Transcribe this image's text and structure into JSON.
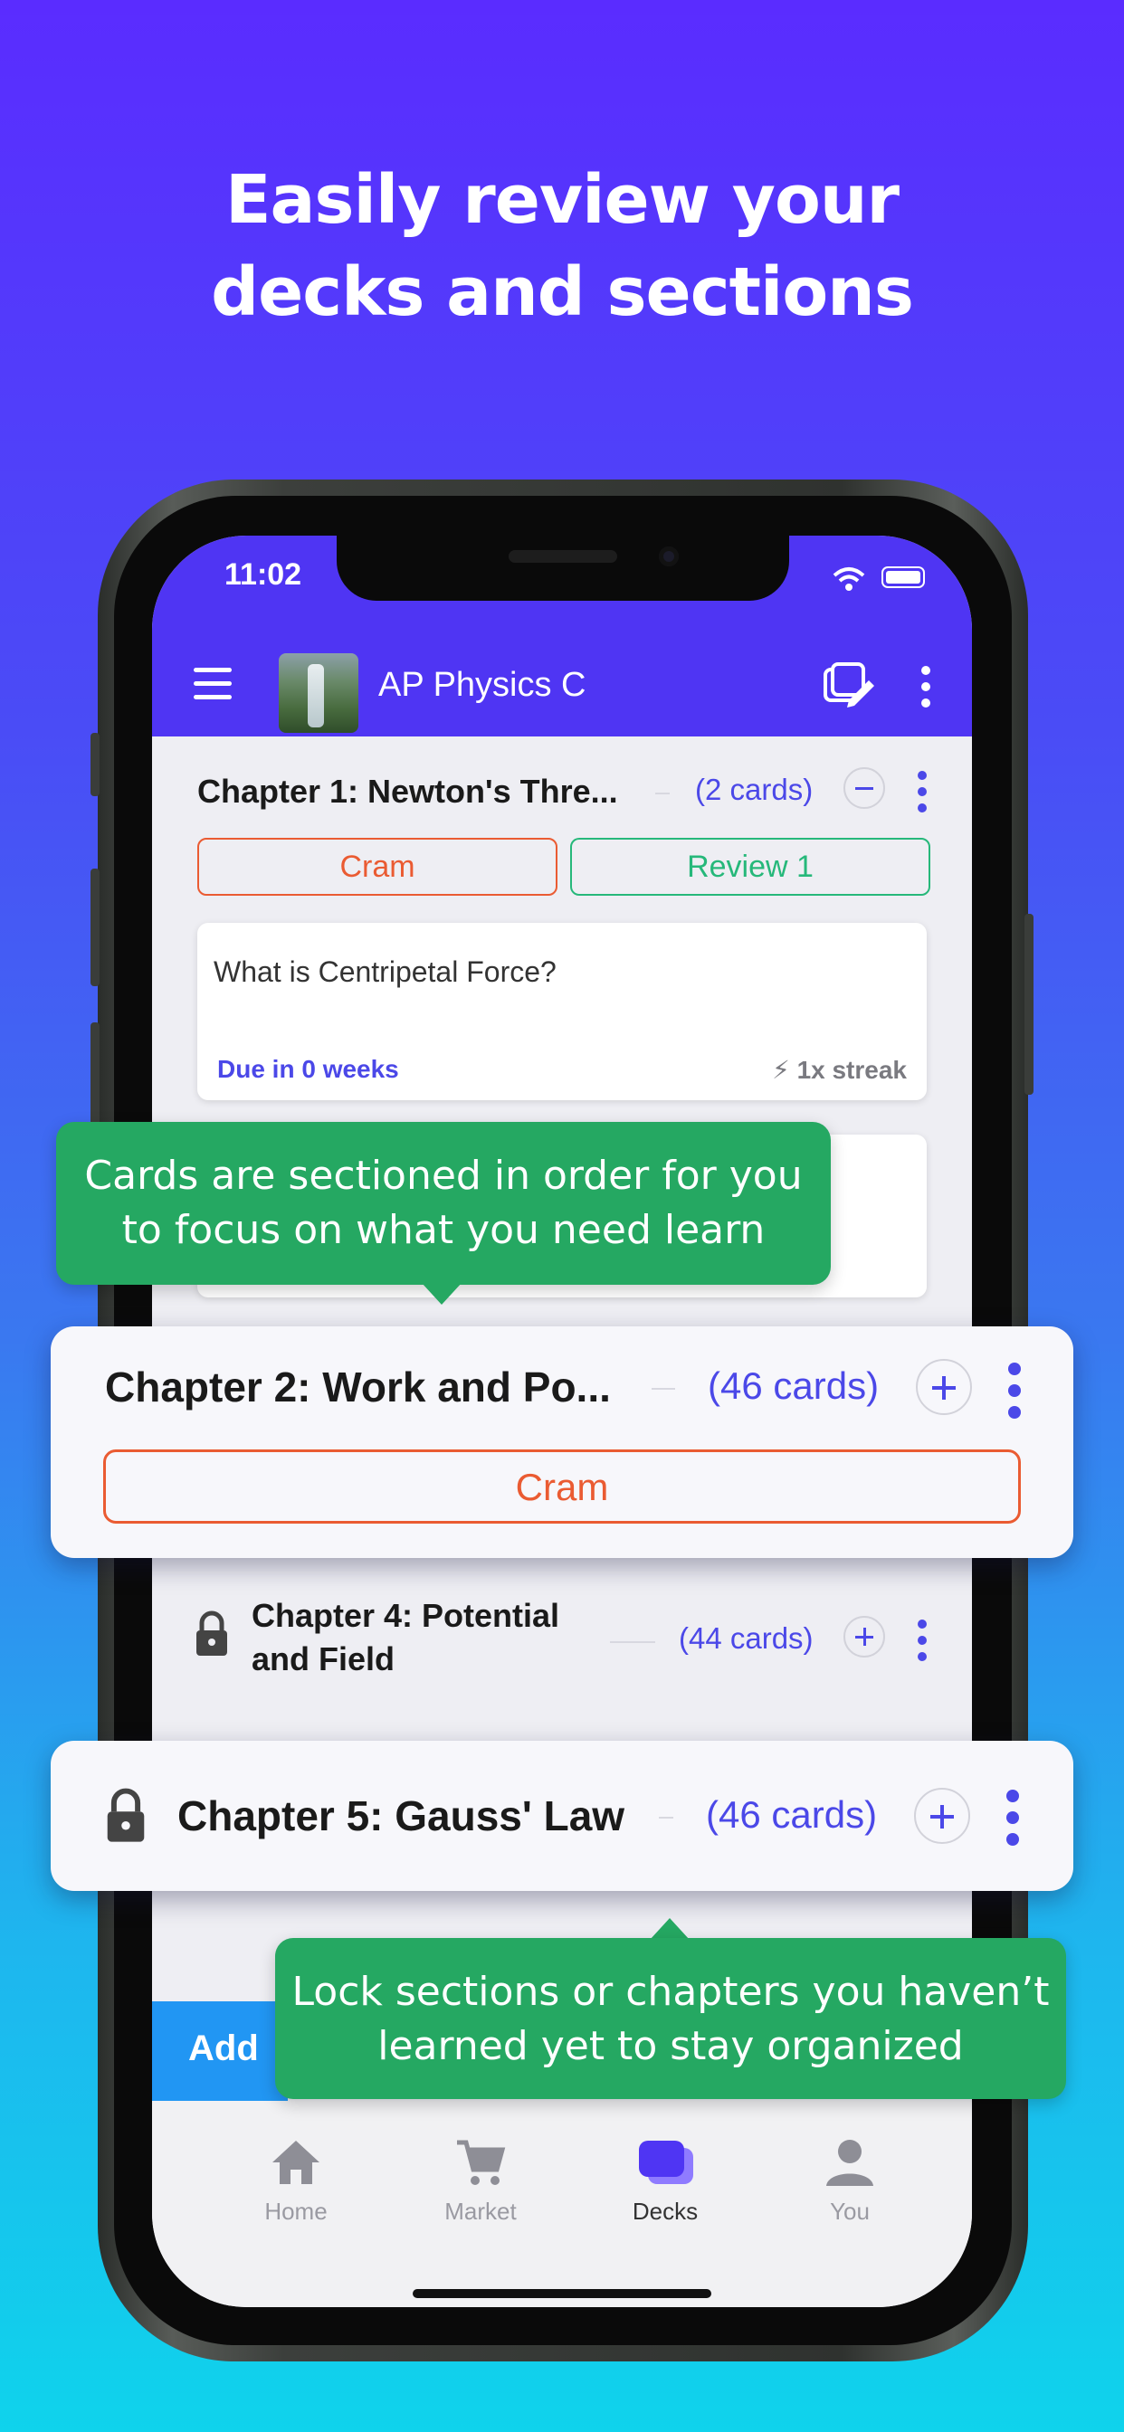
{
  "headline": {
    "line1": "Easily review your",
    "line2": "decks and sections"
  },
  "status": {
    "time": "11:02"
  },
  "appbar": {
    "title": "AP Physics C"
  },
  "sections": {
    "ch1": {
      "title": "Chapter 1: Newton's Thre...",
      "count": "(2 cards)",
      "cram": "Cram",
      "review": "Review 1"
    },
    "card1": {
      "question": "What is Centripetal Force?",
      "due": "Due in 0 weeks",
      "streak": "⚡ 1x streak"
    },
    "ch4": {
      "title_line1": "Chapter 4: Potential",
      "title_line2": "and Field",
      "count": "(44 cards)"
    }
  },
  "overlay_ch2": {
    "title": "Chapter 2: Work and Po...",
    "count": "(46 cards)",
    "cram": "Cram"
  },
  "overlay_ch5": {
    "title": "Chapter 5: Gauss' Law",
    "count": "(46 cards)"
  },
  "bubbles": {
    "top": {
      "line1": "Cards are sectioned in order for you",
      "line2": "to focus on what you need learn"
    },
    "bottom": {
      "line1": "Lock sections or chapters you haven’t",
      "line2": "learned yet to stay organized"
    }
  },
  "add_button": "Add",
  "tabs": [
    {
      "label": "Home",
      "icon": "home-icon"
    },
    {
      "label": "Market",
      "icon": "cart-icon"
    },
    {
      "label": "Decks",
      "icon": "decks-icon"
    },
    {
      "label": "You",
      "icon": "person-icon"
    }
  ],
  "colors": {
    "primary": "#4f35f3",
    "accent": "#4b48e8",
    "cram": "#ea5b32",
    "review": "#26b87a",
    "bubble": "#25a862"
  }
}
